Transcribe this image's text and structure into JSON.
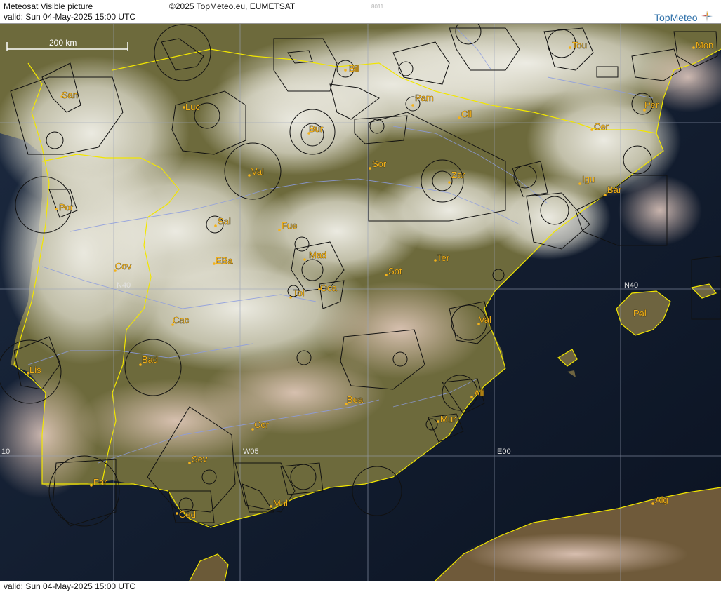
{
  "header": {
    "title": "Meteosat Visible picture",
    "copyright": "©2025 TopMeteo.eu, EUMETSAT",
    "image_code": "8011",
    "valid": "valid:  Sun  04-May-2025  15:00 UTC",
    "logo_text": "TopMeteo"
  },
  "footer": {
    "valid": "valid:  Sun  04-May-2025  15:00 UTC"
  },
  "map": {
    "scale_label": "200 km",
    "grid_labels": [
      {
        "id": "n40-west",
        "text": "N40"
      },
      {
        "id": "n40-east",
        "text": "N40"
      },
      {
        "id": "w10",
        "text": "10"
      },
      {
        "id": "w05",
        "text": "W05"
      },
      {
        "id": "e00",
        "text": "E00"
      }
    ],
    "places": [
      {
        "id": "san",
        "name": "San"
      },
      {
        "id": "luc",
        "name": "Luc"
      },
      {
        "id": "bil",
        "name": "Bil"
      },
      {
        "id": "pam",
        "name": "Pam"
      },
      {
        "id": "cil",
        "name": "Cil"
      },
      {
        "id": "tou",
        "name": "Tou"
      },
      {
        "id": "mon",
        "name": "Mon"
      },
      {
        "id": "per",
        "name": "Per"
      },
      {
        "id": "cer",
        "name": "Cer"
      },
      {
        "id": "bur",
        "name": "Bur"
      },
      {
        "id": "val-n",
        "name": "Val"
      },
      {
        "id": "sor",
        "name": "Sor"
      },
      {
        "id": "zar",
        "name": "Zar"
      },
      {
        "id": "igu",
        "name": "Igu"
      },
      {
        "id": "bar",
        "name": "Bar"
      },
      {
        "id": "por",
        "name": "Por"
      },
      {
        "id": "sal",
        "name": "Sal"
      },
      {
        "id": "fue",
        "name": "Fue"
      },
      {
        "id": "mad",
        "name": "Mad"
      },
      {
        "id": "cov",
        "name": "Cov"
      },
      {
        "id": "eba",
        "name": "EBa"
      },
      {
        "id": "ter",
        "name": "Ter"
      },
      {
        "id": "sot",
        "name": "Sot"
      },
      {
        "id": "tol",
        "name": "Tol"
      },
      {
        "id": "oca",
        "name": "Oca"
      },
      {
        "id": "pal",
        "name": "Pal"
      },
      {
        "id": "cac",
        "name": "Cac"
      },
      {
        "id": "val-e",
        "name": "Val"
      },
      {
        "id": "lis",
        "name": "Lis"
      },
      {
        "id": "bad",
        "name": "Bad"
      },
      {
        "id": "ali",
        "name": "Ali"
      },
      {
        "id": "bea",
        "name": "Bea"
      },
      {
        "id": "mur",
        "name": "Mur"
      },
      {
        "id": "cor",
        "name": "Cor"
      },
      {
        "id": "sev",
        "name": "Sev"
      },
      {
        "id": "far",
        "name": "Far"
      },
      {
        "id": "mal",
        "name": "Mal"
      },
      {
        "id": "ced",
        "name": "Ced"
      },
      {
        "id": "alg",
        "name": "Alg"
      }
    ]
  }
}
